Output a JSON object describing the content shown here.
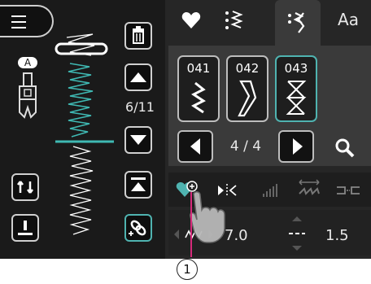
{
  "colors": {
    "accent": "#4fb3b0",
    "background": "#1a1a1a",
    "panel": "#262626",
    "active_tab": "#3a3a3a"
  },
  "left_panel": {
    "menu_icon": "hamburger-menu-icon",
    "presser_foot_letter": "A",
    "page_counter": "6/11"
  },
  "tabs": [
    {
      "name": "favorites",
      "icon": "heart-icon"
    },
    {
      "name": "stitch-list",
      "icon": "stitch-list-icon"
    },
    {
      "name": "stitches",
      "icon": "stitch-pattern-icon",
      "active": true
    },
    {
      "name": "fonts",
      "label": "Aa"
    }
  ],
  "stitches": [
    {
      "number": "041"
    },
    {
      "number": "042"
    },
    {
      "number": "043",
      "selected": true
    }
  ],
  "pager": {
    "label": "4 / 4"
  },
  "tools": [
    {
      "name": "favorite-add",
      "icon": "heart-plus-icon"
    },
    {
      "name": "mirror",
      "icon": "mirror-icon"
    },
    {
      "name": "density",
      "icon": "density-icon"
    },
    {
      "name": "elongation",
      "icon": "elongation-icon"
    },
    {
      "name": "connect",
      "icon": "connect-icon"
    }
  ],
  "settings": {
    "width_value": "7.0",
    "length_value": "1.5"
  },
  "callout": {
    "label": "1"
  }
}
